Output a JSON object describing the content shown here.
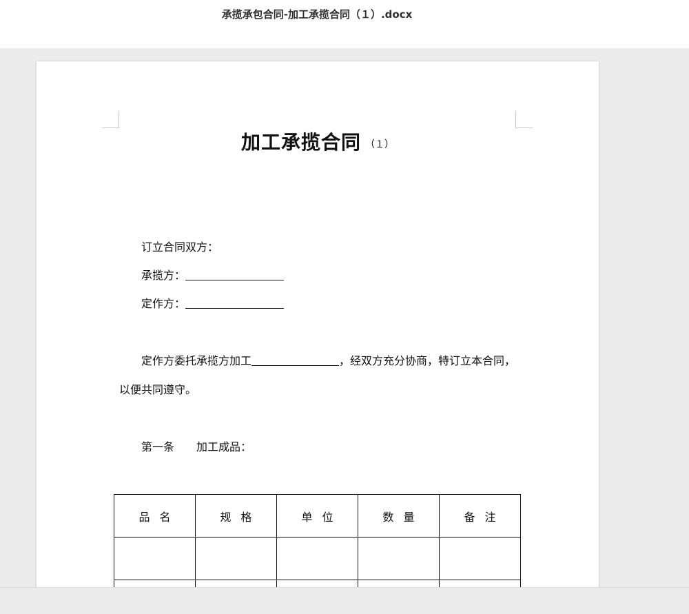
{
  "window": {
    "file_title": "承揽承包合同-加工承揽合同（１）.docx"
  },
  "document": {
    "title": "加工承揽合同",
    "title_suffix": "（１）",
    "parties_heading": "订立合同双方：",
    "contractor_label": "承揽方：",
    "client_label": "定作方：",
    "intro_part1": "定作方委托承揽方加工",
    "intro_part2": "，经双方充分协商，特订立本合同，",
    "intro_line2": "以便共同遵守。",
    "article1_number": "第一条",
    "article1_title": "加工成品：",
    "table": {
      "headers": [
        "品名",
        "规格",
        "单位",
        "数量",
        "备注"
      ],
      "rows": [
        [
          "",
          "",
          "",
          "",
          ""
        ],
        [
          "",
          "",
          "",
          "",
          ""
        ]
      ]
    }
  }
}
